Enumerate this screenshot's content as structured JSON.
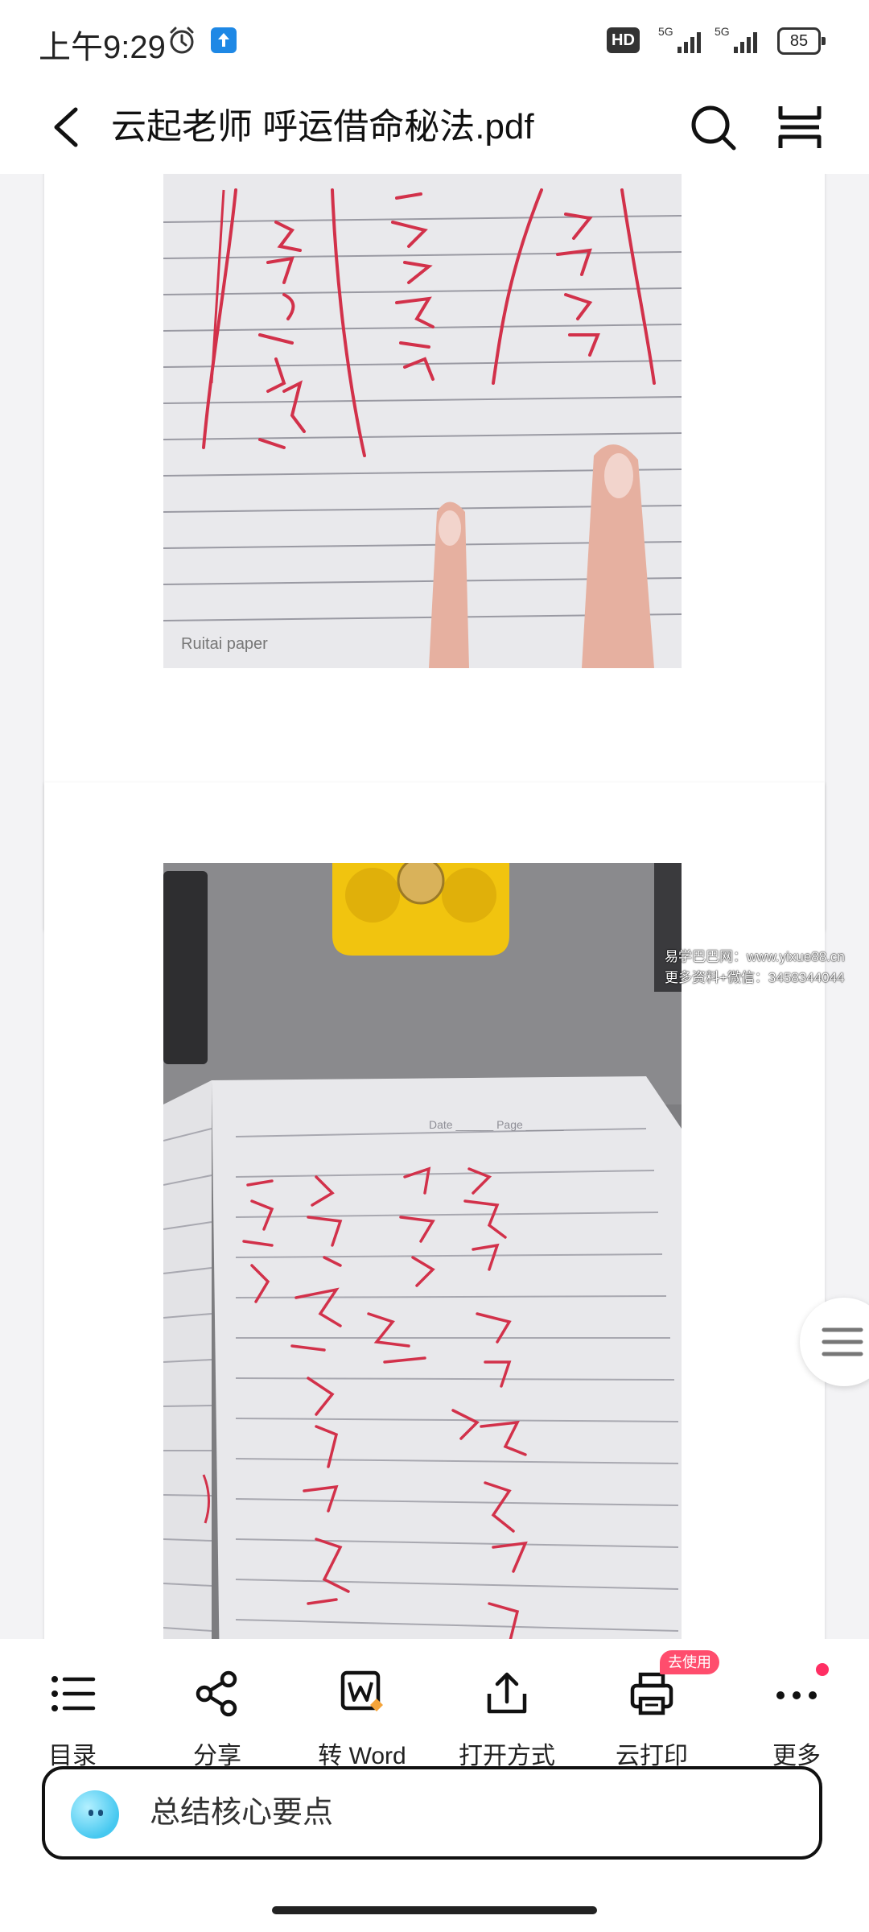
{
  "status_bar": {
    "time": "上午9:29",
    "network_badge": "HD",
    "signal_1_label": "5G",
    "signal_2_label": "5G",
    "battery": "85",
    "icons": [
      "alarm-icon",
      "upload-notification-icon",
      "signal-icon",
      "battery-icon"
    ]
  },
  "header": {
    "title": "云起老师 呼运借命秘法.pdf",
    "icons": [
      "back-icon",
      "search-icon",
      "layout-icon"
    ]
  },
  "document": {
    "page1_photo_caption": "Ruitai paper",
    "page2_photo_header": "Date ______  Page ______",
    "watermark_line1": "易学巴巴网：www.yixue88.cn",
    "watermark_line2": "更多资料+微信：3458344044"
  },
  "toolbar": {
    "items": [
      {
        "label": "目录",
        "icon": "list-icon"
      },
      {
        "label": "分享",
        "icon": "share-icon"
      },
      {
        "label": "转 Word",
        "icon": "to-word-icon"
      },
      {
        "label": "打开方式",
        "icon": "open-with-icon"
      },
      {
        "label": "云打印",
        "icon": "print-icon",
        "badge": "去使用"
      },
      {
        "label": "更多",
        "icon": "more-icon"
      }
    ]
  },
  "ai_assistant": {
    "label": "总结核心要点"
  },
  "colors": {
    "accent_badge": "#ff4d6d",
    "avatar": "#46c8f0",
    "ink_red": "#d2314a"
  }
}
